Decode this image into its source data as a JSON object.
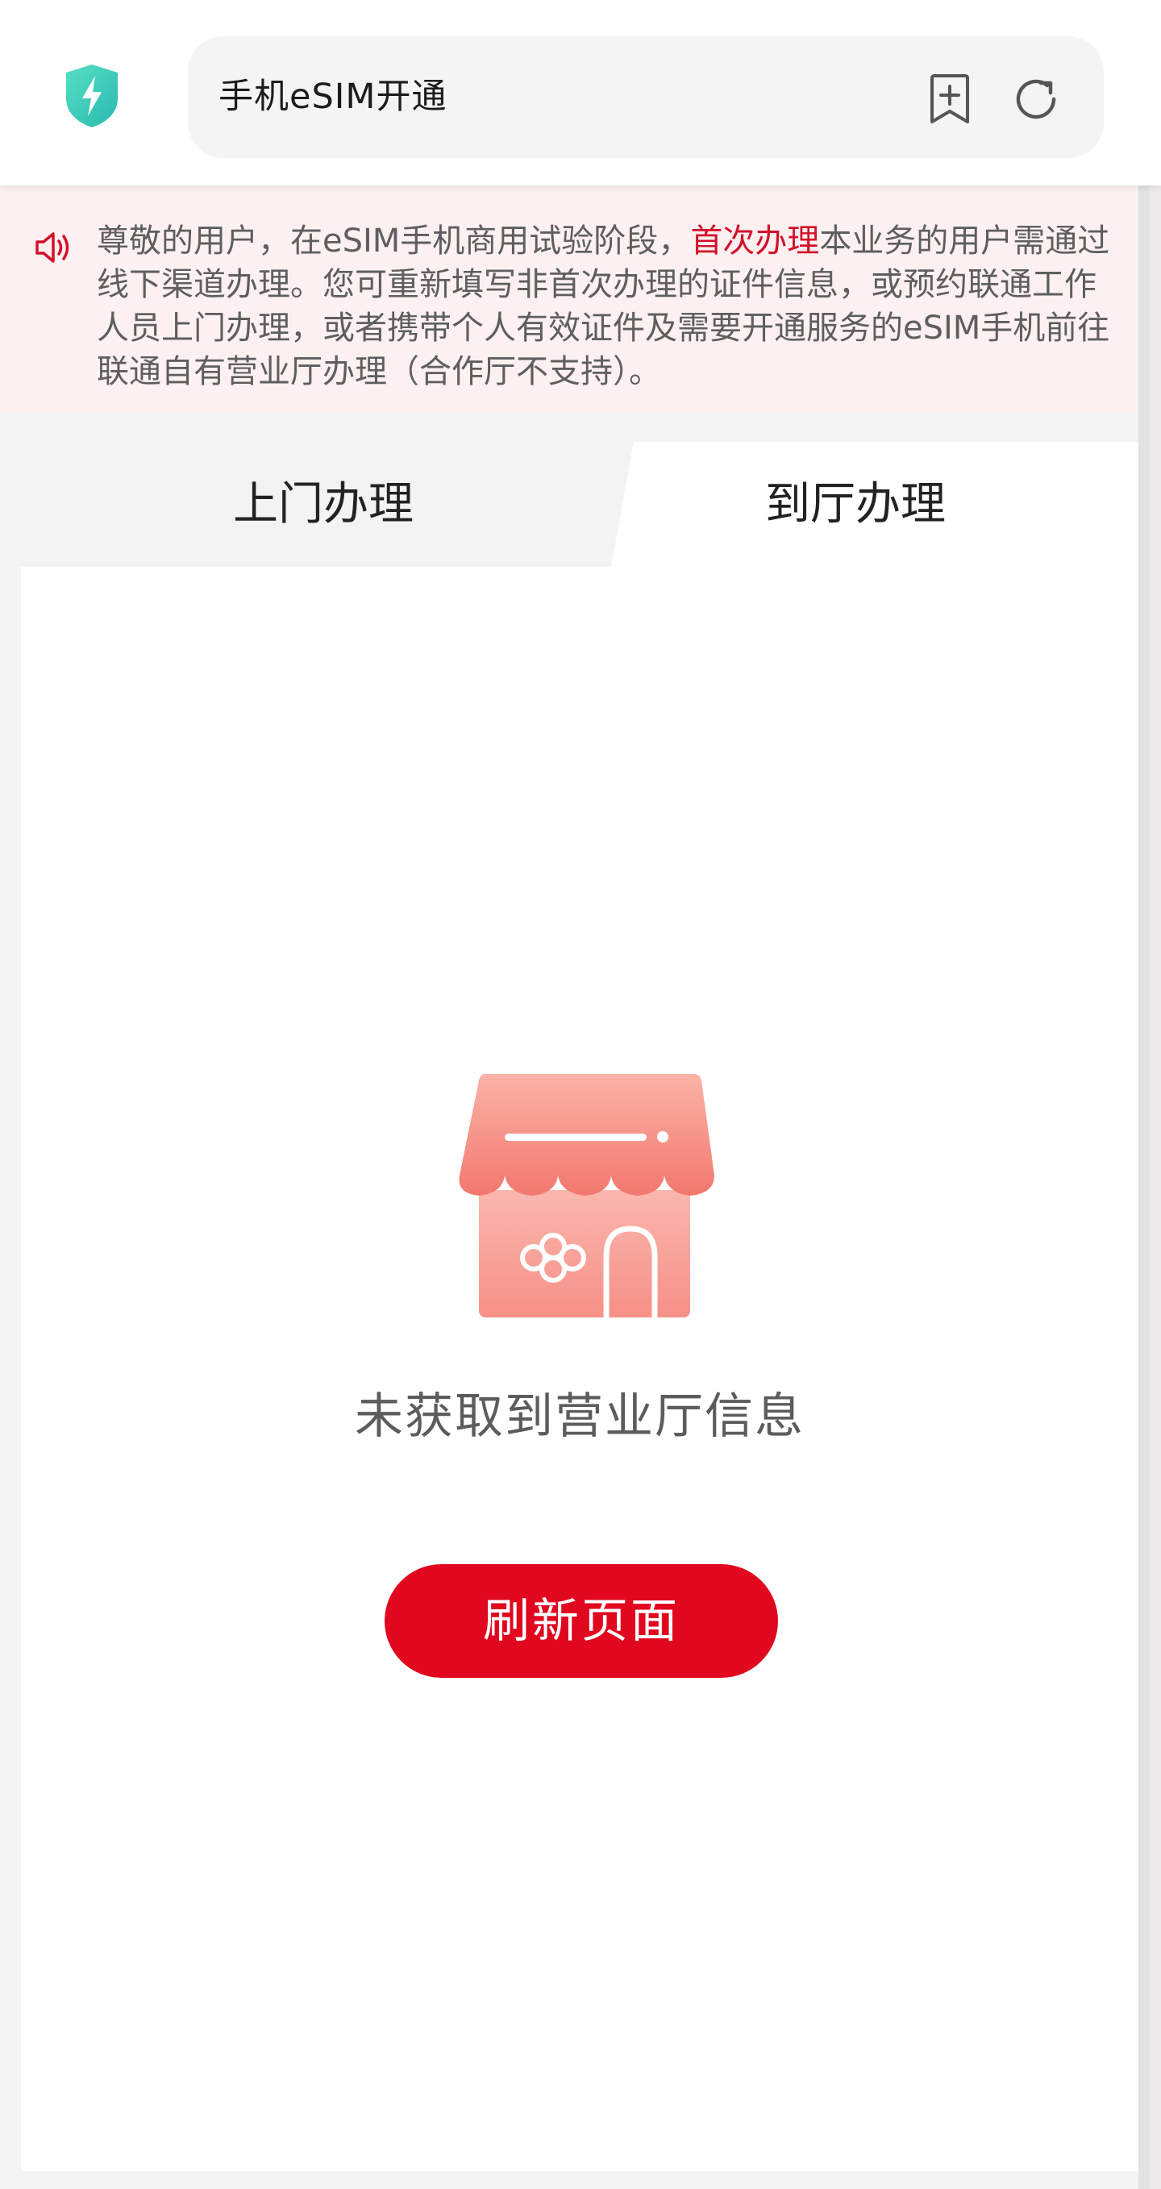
{
  "browser": {
    "page_title": "手机eSIM开通",
    "icons": {
      "security": "shield-lightning-icon",
      "bookmark": "add-bookmark-icon",
      "refresh": "refresh-icon"
    }
  },
  "notice": {
    "icon": "speaker-icon",
    "text_before": "尊敬的用户，在eSIM手机商用试验阶段，",
    "highlight": "首次办理",
    "text_after": "本业务的用户需通过线下渠道办理。您可重新填写非首次办理的证件信息，或预约联通工作人员上门办理，或者携带个人有效证件及需要开通服务的eSIM手机前往联通自有营业厅办理（合作厅不支持）。",
    "highlight_color": "#d4102a"
  },
  "tabs": [
    {
      "label": "上门办理",
      "active": false
    },
    {
      "label": "到厅办理",
      "active": true
    }
  ],
  "empty_state": {
    "illustration": "store-icon",
    "message": "未获取到营业厅信息",
    "button_label": "刷新页面"
  },
  "colors": {
    "accent": "#e0071f",
    "shield": "#3fcfb4"
  }
}
